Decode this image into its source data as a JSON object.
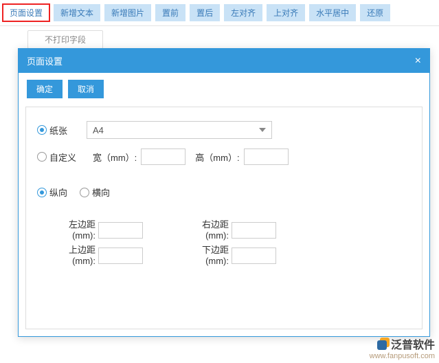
{
  "toolbar": [
    {
      "label": "页面设置",
      "active": true
    },
    {
      "label": "新增文本"
    },
    {
      "label": "新增图片"
    },
    {
      "label": "置前"
    },
    {
      "label": "置后"
    },
    {
      "label": "左对齐"
    },
    {
      "label": "上对齐"
    },
    {
      "label": "水平居中"
    },
    {
      "label": "还原"
    }
  ],
  "subbar": {
    "tab1": "不打印字段"
  },
  "dialog": {
    "title": "页面设置",
    "ok": "确定",
    "cancel": "取消",
    "paper": {
      "radio_paper": "纸张",
      "radio_custom": "自定义",
      "select_value": "A4",
      "width_label": "宽（mm）:",
      "height_label": "高（mm）:",
      "width_value": "",
      "height_value": ""
    },
    "orient": {
      "portrait": "纵向",
      "landscape": "横向"
    },
    "margins": {
      "left_label": "左边距(mm):",
      "right_label": "右边距(mm):",
      "top_label": "上边距(mm):",
      "bottom_label": "下边距(mm):",
      "left_value": "",
      "right_value": "",
      "top_value": "",
      "bottom_value": ""
    }
  },
  "watermark": {
    "brand": "泛普软件",
    "url": "www.fanpusoft.com"
  }
}
